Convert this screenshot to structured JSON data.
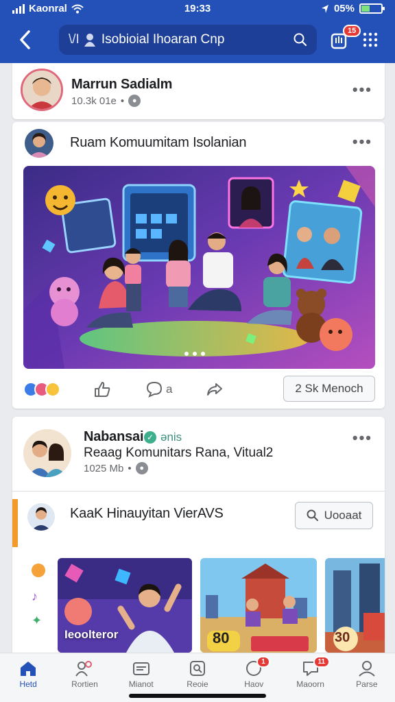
{
  "status": {
    "carrier": "Kaonral",
    "time": "19:33",
    "battery": "05%"
  },
  "header": {
    "search_prefix": "\\/I",
    "search_text": "Isobioial Ihoaran Cnp",
    "notif_count": "15"
  },
  "posts": [
    {
      "name": "Marrun Sadialm",
      "meta": "10.3k 01e"
    },
    {
      "name": "Ruam Komuumitam Isolanian",
      "reactions_label": "",
      "like": "",
      "comment": "a",
      "share": "",
      "message_button": "2 Sk Menoch"
    },
    {
      "name": "Nabansai",
      "verified_tag": "ənis",
      "subtitle": "Reaag Komunitars Rana, Vitual2",
      "meta": "1025 Mb"
    }
  ],
  "embedded": {
    "title": "KaaK Hinauyitan VierAVS",
    "watch_label": "Uooaat",
    "cards": [
      {
        "caption": "Ieoolteror"
      },
      {
        "caption": "80"
      },
      {
        "caption": "30"
      }
    ]
  },
  "nav": {
    "items": [
      {
        "label": "Hetd"
      },
      {
        "label": "Rortien"
      },
      {
        "label": "Mianot"
      },
      {
        "label": "Reoie"
      },
      {
        "label": "Haov",
        "badge": "1"
      },
      {
        "label": "Maoorn",
        "badge": "11"
      },
      {
        "label": "Parse"
      }
    ]
  },
  "colors": {
    "brand": "#2451b8",
    "accent": "#f39b2a",
    "badge": "#e53935"
  }
}
